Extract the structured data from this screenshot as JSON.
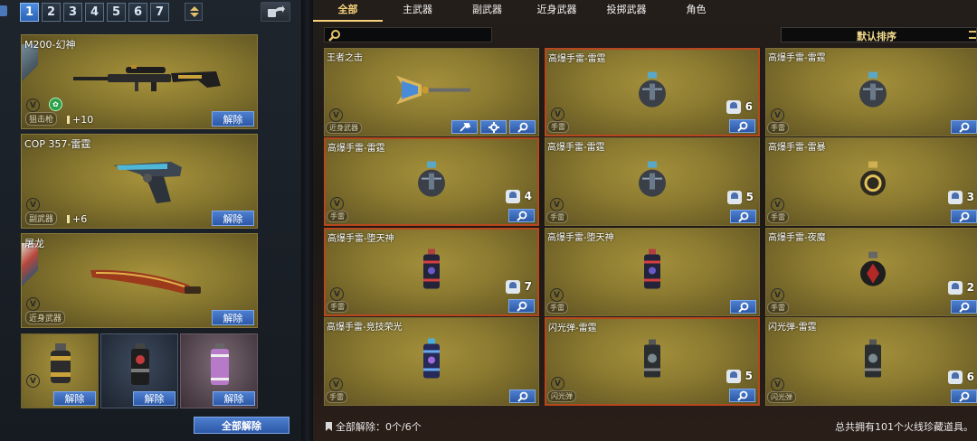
{
  "page_tabs": [
    "1",
    "2",
    "3",
    "4",
    "5",
    "6",
    "7"
  ],
  "active_page_tab": "1",
  "equipped": {
    "slots": [
      {
        "name": "M200-幻神",
        "tag": "狙击枪",
        "bonus": "+10"
      },
      {
        "name": "COP 357-雷霆",
        "tag": "副武器",
        "bonus": "+6"
      },
      {
        "name": "屠龙",
        "tag": "近身武器",
        "bonus": ""
      }
    ],
    "unequip_label": "解除",
    "v_badge": "V",
    "unequip_all_label": "全部解除"
  },
  "category_tabs": [
    "全部",
    "主武器",
    "副武器",
    "近身武器",
    "投掷武器",
    "角色"
  ],
  "active_category": "全部",
  "search": {
    "placeholder": "",
    "value": ""
  },
  "sort": {
    "label": "默认排序"
  },
  "items": [
    {
      "name": "王者之击",
      "tag": "近身武器",
      "count": "",
      "selected": false,
      "art": "axe"
    },
    {
      "name": "高爆手雷-雷霆",
      "tag": "手雷",
      "count": "6",
      "selected": true,
      "art": "grenade"
    },
    {
      "name": "高爆手雷-雷霆",
      "tag": "手雷",
      "count": "",
      "selected": false,
      "art": "grenade"
    },
    {
      "name": "高爆手雷-雷霆",
      "tag": "手雷",
      "count": "4",
      "selected": true,
      "art": "grenade"
    },
    {
      "name": "高爆手雷-雷霆",
      "tag": "手雷",
      "count": "5",
      "selected": false,
      "art": "grenade"
    },
    {
      "name": "高爆手雷-雷暴",
      "tag": "手雷",
      "count": "3",
      "selected": false,
      "art": "grenade-gold"
    },
    {
      "name": "高爆手雷-堕天神",
      "tag": "手雷",
      "count": "7",
      "selected": true,
      "art": "canister-red"
    },
    {
      "name": "高爆手雷-堕天神",
      "tag": "手雷",
      "count": "",
      "selected": false,
      "art": "canister-red"
    },
    {
      "name": "高爆手雷-夜魔",
      "tag": "手雷",
      "count": "2",
      "selected": false,
      "art": "grenade-dark"
    },
    {
      "name": "高爆手雷-竞技荣光",
      "tag": "手雷",
      "count": "",
      "selected": false,
      "art": "canister-blue"
    },
    {
      "name": "闪光弹-雷霆",
      "tag": "闪光弹",
      "count": "5",
      "selected": true,
      "art": "flash"
    },
    {
      "name": "闪光弹-雷霆",
      "tag": "闪光弹",
      "count": "6",
      "selected": false,
      "art": "flash"
    }
  ],
  "footer": {
    "unequip_status": "全部解除：0个/6个",
    "total_owned": "总共拥有101个火线珍藏道具。"
  },
  "icons": {
    "search": "magnifier-icon",
    "settings": "gear-icon",
    "share": "share-arrow-icon",
    "mode": "mode-icon"
  }
}
